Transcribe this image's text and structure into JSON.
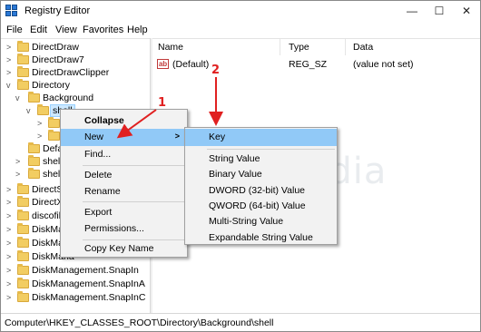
{
  "window": {
    "title": "Registry Editor",
    "controls": {
      "minimize": "—",
      "maximize": "☐",
      "close": "✕"
    }
  },
  "menubar": [
    "File",
    "Edit",
    "View",
    "Favorites",
    "Help"
  ],
  "tree": {
    "items": [
      {
        "label": "DirectDraw",
        "chevron": ">"
      },
      {
        "label": "DirectDraw7",
        "chevron": ">"
      },
      {
        "label": "DirectDrawClipper",
        "chevron": ">"
      },
      {
        "label": "Directory",
        "chevron": "v"
      },
      {
        "label": "Background",
        "chevron": "v"
      },
      {
        "label": "shell",
        "chevron": "v"
      },
      {
        "label": "",
        "chevron": ">"
      },
      {
        "label": "s",
        "chevron": ">"
      },
      {
        "label": "Defa",
        "chevron": ""
      },
      {
        "label": "shel",
        "chevron": ">"
      },
      {
        "label": "shel",
        "chevron": ">"
      },
      {
        "label": "DirectSh",
        "chevron": ">"
      },
      {
        "label": "DirectXI",
        "chevron": ">"
      },
      {
        "label": "discofile",
        "chevron": ">"
      },
      {
        "label": "DiskMana",
        "chevron": ">"
      },
      {
        "label": "DiskMana",
        "chevron": ">"
      },
      {
        "label": "DiskMana",
        "chevron": ">"
      },
      {
        "label": "DiskManagement.SnapIn",
        "chevron": ">"
      },
      {
        "label": "DiskManagement.SnapInA",
        "chevron": ">"
      },
      {
        "label": "DiskManagement.SnapInC",
        "chevron": ">"
      }
    ]
  },
  "list": {
    "columns": [
      "Name",
      "Type",
      "Data"
    ],
    "rows": [
      {
        "icon": "ab",
        "name": "(Default)",
        "type": "REG_SZ",
        "data": "(value not set)"
      }
    ]
  },
  "watermark": "TeknoMedia",
  "status": "Computer\\HKEY_CLASSES_ROOT\\Directory\\Background\\shell",
  "context_menu": {
    "items": [
      "Collapse",
      "New",
      "Find...",
      "Delete",
      "Rename",
      "Export",
      "Permissions...",
      "Copy Key Name"
    ],
    "submenu_arrow": ">"
  },
  "new_submenu": {
    "items": [
      "Key",
      "String Value",
      "Binary Value",
      "DWORD (32-bit) Value",
      "QWORD (64-bit) Value",
      "Multi-String Value",
      "Expandable String Value"
    ]
  },
  "annotations": {
    "step1": "1",
    "step2": "2"
  },
  "colors": {
    "highlight": "#91c9f7",
    "selection": "#cce8ff",
    "arrow": "#e02020",
    "folder": "#f2cd62"
  }
}
